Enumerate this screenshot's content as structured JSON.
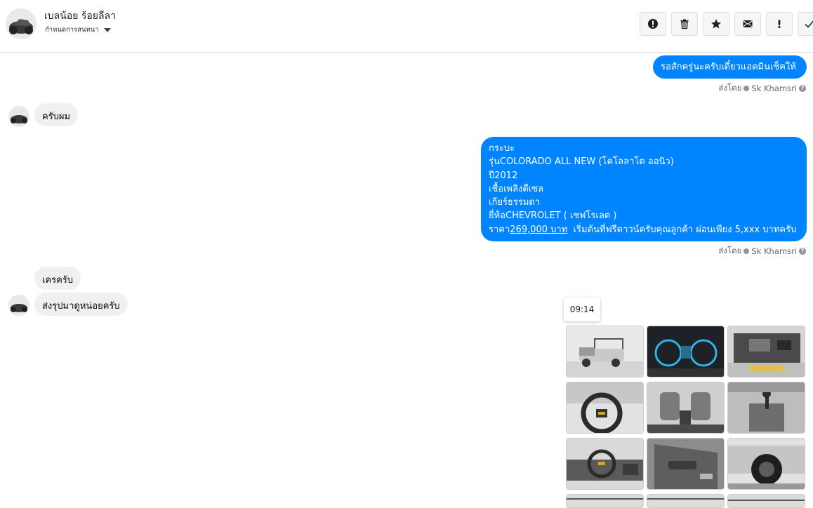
{
  "header": {
    "contact_name": "เบลน้อย ร้อยลีลา",
    "conversation_settings": "กำหนดการสนทนา",
    "actions": [
      "mark-spam",
      "delete",
      "star",
      "mark-unread",
      "important",
      "done"
    ],
    "important_label": "!"
  },
  "messages": {
    "m1": "รอสักครู่นะครับเดี๋ยวแอดมินเช็คให้",
    "sent_by_1": {
      "prefix": "ส่งโดย",
      "name": "Sk Khamsri"
    },
    "m2": "ครับผม",
    "m3": {
      "lines": [
        "กระบะ",
        "รุ่นCOLORADO ALL NEW (โคโลลาโด ออนิว)",
        "ปี2012",
        "เชื้อเพลิงดีเซล",
        "เกียร์ธรรมดา",
        "ยี่ห้อCHEVROLET ( เชฟโรเลต )"
      ],
      "price_prefix": "ราคา",
      "price": "269,000 บาท",
      "price_suffix": "  เริ่มต้นที่ฟรีดาวน์ครับคุณลูกค้า ผ่อนเพียง 5,xxx บาทครับ"
    },
    "sent_by_2": {
      "prefix": "ส่งโดย",
      "name": "Sk Khamsri"
    },
    "m4": "เครครับ",
    "m5": "ส่งรุปมาดูหน่อยครับ",
    "timestamp": "09:14"
  },
  "photos": [
    "truck-exterior",
    "speedometer",
    "engine-bay",
    "steering-wheel",
    "seats-front",
    "gear-shifter",
    "dashboard",
    "door-panel",
    "wheel-tire",
    "ceiling-1",
    "ceiling-2",
    "ceiling-3"
  ],
  "colors": {
    "outgoing": "#0084ff",
    "incoming": "#f0f0f0"
  }
}
